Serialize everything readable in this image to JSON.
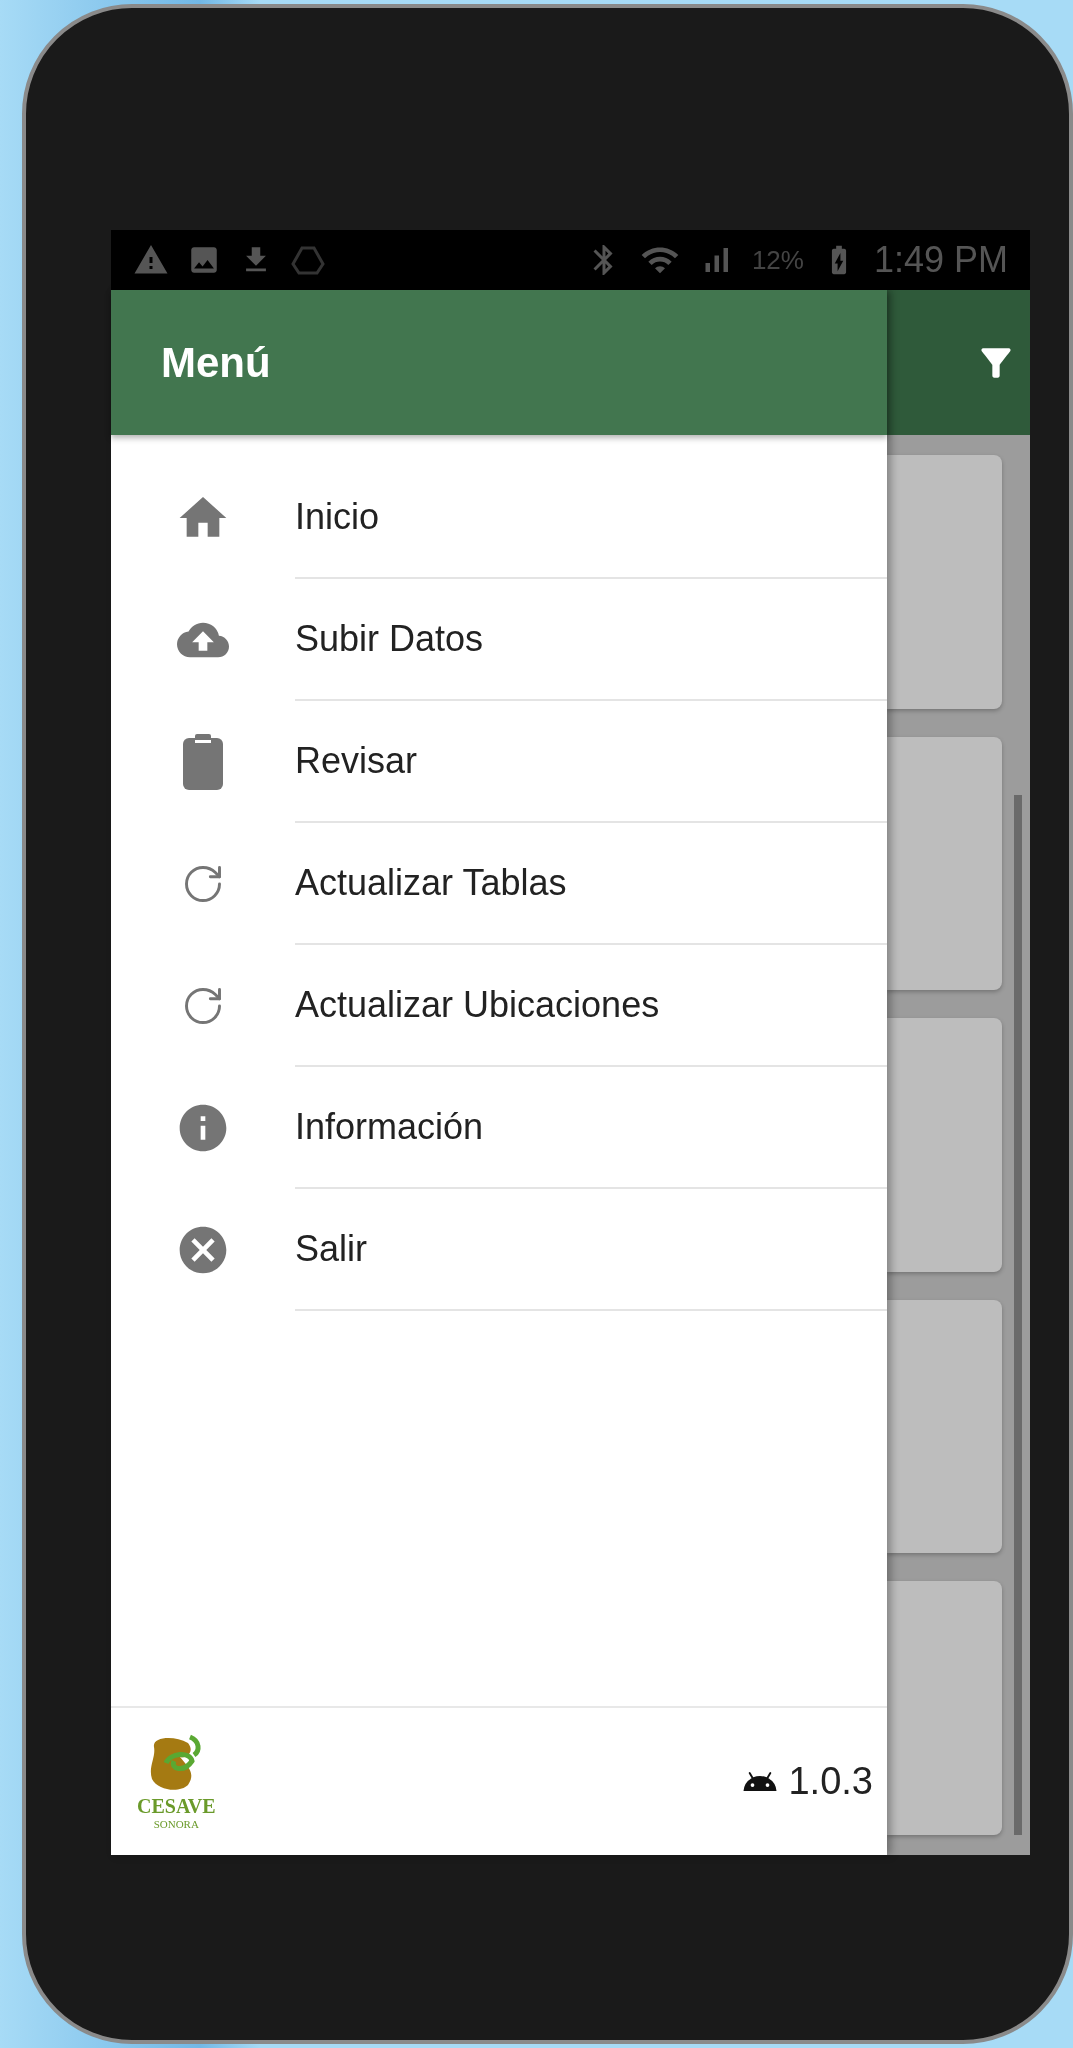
{
  "status_bar": {
    "battery": "12%",
    "time": "1:49 PM"
  },
  "app_bar": {
    "title": "Menú"
  },
  "menu": {
    "items": [
      {
        "kind": "home",
        "label": "Inicio"
      },
      {
        "kind": "upload",
        "label": "Subir Datos"
      },
      {
        "kind": "clipboard",
        "label": "Revisar"
      },
      {
        "kind": "refresh",
        "label": "Actualizar Tablas"
      },
      {
        "kind": "refresh",
        "label": "Actualizar Ubicaciones"
      },
      {
        "kind": "info",
        "label": "Información"
      },
      {
        "kind": "exit",
        "label": "Salir"
      }
    ]
  },
  "footer": {
    "logo_name": "CESAVE",
    "logo_region": "SONORA",
    "version": "1.0.3"
  }
}
